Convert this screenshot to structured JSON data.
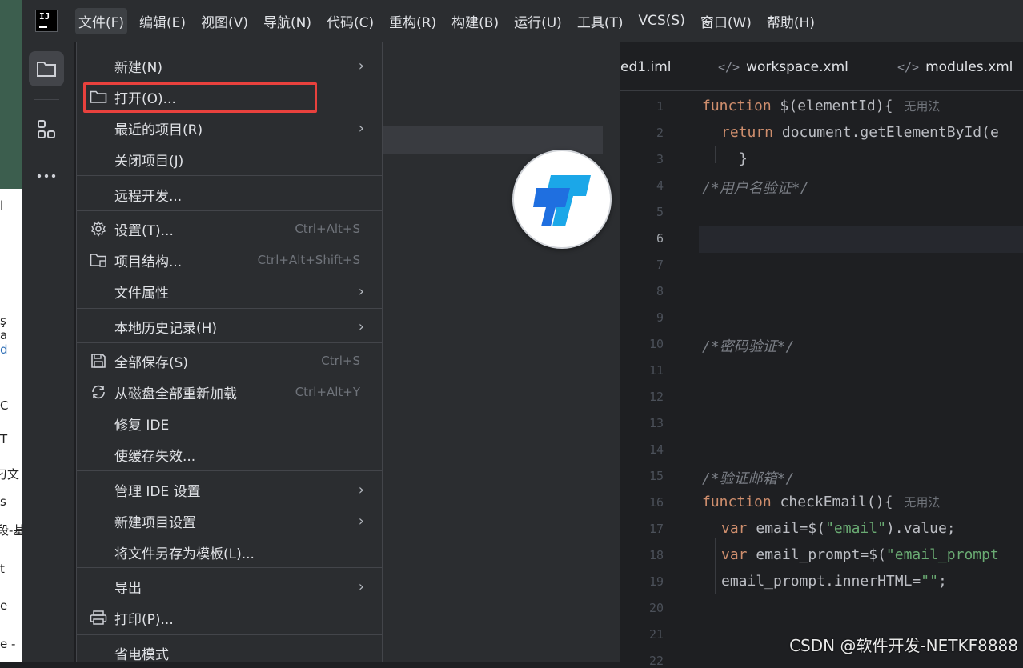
{
  "background_window": {
    "fragments": [
      "l",
      "ş",
      "a",
      "d",
      "C",
      "T",
      "刁文",
      "s",
      "段-基",
      "t",
      "e",
      "e -"
    ]
  },
  "menubar": {
    "logo_text": "IJ",
    "items": [
      "文件(F)",
      "编辑(E)",
      "视图(V)",
      "导航(N)",
      "代码(C)",
      "重构(R)",
      "构建(B)",
      "运行(U)",
      "工具(T)",
      "VCS(S)",
      "窗口(W)",
      "帮助(H)"
    ]
  },
  "file_menu": {
    "items": [
      {
        "label": "新建(N)",
        "shortcut": "",
        "submenu": true,
        "icon": ""
      },
      {
        "label": "打开(O)...",
        "shortcut": "",
        "submenu": false,
        "icon": "folder-icon"
      },
      {
        "label": "最近的项目(R)",
        "shortcut": "",
        "submenu": true,
        "icon": ""
      },
      {
        "label": "关闭项目(J)",
        "shortcut": "",
        "submenu": false,
        "icon": ""
      },
      {
        "label": "远程开发...",
        "shortcut": "",
        "submenu": false,
        "icon": ""
      },
      {
        "label": "设置(T)...",
        "shortcut": "Ctrl+Alt+S",
        "submenu": false,
        "icon": "gear-icon"
      },
      {
        "label": "项目结构...",
        "shortcut": "Ctrl+Alt+Shift+S",
        "submenu": false,
        "icon": "project-structure-icon"
      },
      {
        "label": "文件属性",
        "shortcut": "",
        "submenu": true,
        "icon": ""
      },
      {
        "label": "本地历史记录(H)",
        "shortcut": "",
        "submenu": true,
        "icon": ""
      },
      {
        "label": "全部保存(S)",
        "shortcut": "Ctrl+S",
        "submenu": false,
        "icon": "save-icon"
      },
      {
        "label": "从磁盘全部重新加载",
        "shortcut": "Ctrl+Alt+Y",
        "submenu": false,
        "icon": "reload-icon"
      },
      {
        "label": "修复 IDE",
        "shortcut": "",
        "submenu": false,
        "icon": ""
      },
      {
        "label": "使缓存失效...",
        "shortcut": "",
        "submenu": false,
        "icon": ""
      },
      {
        "label": "管理 IDE 设置",
        "shortcut": "",
        "submenu": true,
        "icon": ""
      },
      {
        "label": "新建项目设置",
        "shortcut": "",
        "submenu": true,
        "icon": ""
      },
      {
        "label": "将文件另存为模板(L)...",
        "shortcut": "",
        "submenu": false,
        "icon": ""
      },
      {
        "label": "导出",
        "shortcut": "",
        "submenu": true,
        "icon": ""
      },
      {
        "label": "打印(P)...",
        "shortcut": "",
        "submenu": false,
        "icon": "print-icon"
      },
      {
        "label": "省电模式",
        "shortcut": "",
        "submenu": false,
        "icon": ""
      }
    ],
    "highlighted_item": "打开(O)...",
    "highlight_color": "#e8413d"
  },
  "editor": {
    "tabs": [
      {
        "label": "ed1.iml",
        "icon": ""
      },
      {
        "label": "workspace.xml",
        "icon": "xml-icon"
      },
      {
        "label": "modules.xml",
        "icon": "xml-icon"
      }
    ],
    "line_numbers": [
      "1",
      "2",
      "3",
      "4",
      "5",
      "6",
      "7",
      "8",
      "9",
      "10",
      "11",
      "12",
      "13",
      "14",
      "15",
      "16",
      "17",
      "18",
      "19",
      "20",
      "21",
      "22"
    ],
    "current_line": "6",
    "hint_no_usages": "无用法",
    "code": {
      "l1_kw": "function",
      "l1_rest": " $(elementId){",
      "l2_kw": "return",
      "l2_rest": " document.getElementById(e",
      "l3": "}",
      "l4": "/*用户名验证*/",
      "l10": "/*密码验证*/",
      "l15": "/*验证邮箱*/",
      "l16_kw": "function",
      "l16_rest": " checkEmail(){",
      "l17_kw": "var",
      "l17_a": " email=$(",
      "l17_str": "\"email\"",
      "l17_b": ").value;",
      "l18_kw": "var",
      "l18_a": " email_prompt=$(",
      "l18_str": "\"email_prompt",
      "l19_a": "email_prompt.innerHTML=",
      "l19_str": "\"\"",
      "l19_b": ";"
    }
  },
  "watermark": "CSDN @软件开发-NETKF8888",
  "colors": {
    "menubar_bg": "#2b2d30",
    "editor_bg": "#1e1f22",
    "keyword": "#cf8e6d",
    "string": "#6aab73",
    "comment": "#7a7e85"
  }
}
